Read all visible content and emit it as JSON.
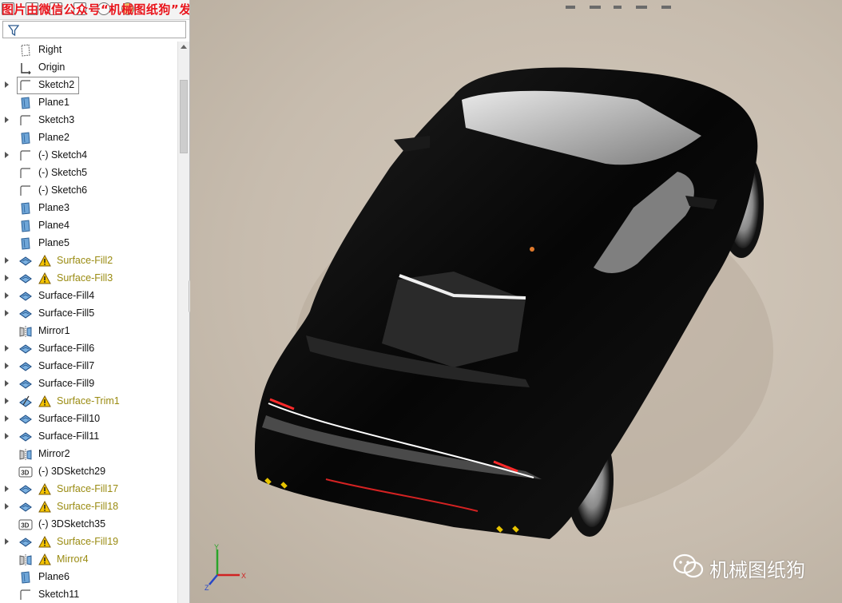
{
  "watermark_top": "图片由微信公众号“机械图纸狗”发布",
  "watermark_brand": "机械图纸狗",
  "colors": {
    "warning_text": "#9a8b12",
    "watermark_red": "#e8141b",
    "viewport_bg": "#c9bfb2",
    "car_body": "#0b0b0b"
  },
  "tree": {
    "items": [
      {
        "label": "Right",
        "icon": "plane-icon-outline",
        "expand": false,
        "warn": false
      },
      {
        "label": "Origin",
        "icon": "origin-icon",
        "expand": false,
        "warn": false
      },
      {
        "label": "Sketch2",
        "icon": "sketch-icon",
        "expand": true,
        "warn": false,
        "selected": true
      },
      {
        "label": "Plane1",
        "icon": "plane-icon",
        "expand": false,
        "warn": false
      },
      {
        "label": "Sketch3",
        "icon": "sketch-icon",
        "expand": true,
        "warn": false
      },
      {
        "label": "Plane2",
        "icon": "plane-icon",
        "expand": false,
        "warn": false
      },
      {
        "label": "(-) Sketch4",
        "icon": "sketch-icon",
        "expand": true,
        "warn": false
      },
      {
        "label": "(-) Sketch5",
        "icon": "sketch-icon",
        "expand": false,
        "warn": false
      },
      {
        "label": "(-) Sketch6",
        "icon": "sketch-icon",
        "expand": false,
        "warn": false
      },
      {
        "label": "Plane3",
        "icon": "plane-icon",
        "expand": false,
        "warn": false
      },
      {
        "label": "Plane4",
        "icon": "plane-icon",
        "expand": false,
        "warn": false
      },
      {
        "label": "Plane5",
        "icon": "plane-icon",
        "expand": false,
        "warn": false
      },
      {
        "label": "Surface-Fill2",
        "icon": "surface-fill-icon",
        "expand": true,
        "warn": true
      },
      {
        "label": "Surface-Fill3",
        "icon": "surface-fill-icon",
        "expand": true,
        "warn": true
      },
      {
        "label": "Surface-Fill4",
        "icon": "surface-fill-icon",
        "expand": true,
        "warn": false
      },
      {
        "label": "Surface-Fill5",
        "icon": "surface-fill-icon",
        "expand": true,
        "warn": false
      },
      {
        "label": "Mirror1",
        "icon": "mirror-icon",
        "expand": false,
        "warn": false
      },
      {
        "label": "Surface-Fill6",
        "icon": "surface-fill-icon",
        "expand": true,
        "warn": false
      },
      {
        "label": "Surface-Fill7",
        "icon": "surface-fill-icon",
        "expand": true,
        "warn": false
      },
      {
        "label": "Surface-Fill9",
        "icon": "surface-fill-icon",
        "expand": true,
        "warn": false
      },
      {
        "label": "Surface-Trim1",
        "icon": "surface-trim-icon",
        "expand": true,
        "warn": true
      },
      {
        "label": "Surface-Fill10",
        "icon": "surface-fill-icon",
        "expand": true,
        "warn": false
      },
      {
        "label": "Surface-Fill11",
        "icon": "surface-fill-icon",
        "expand": true,
        "warn": false
      },
      {
        "label": "Mirror2",
        "icon": "mirror-icon",
        "expand": false,
        "warn": false
      },
      {
        "label": "(-) 3DSketch29",
        "icon": "3dsketch-icon",
        "expand": false,
        "warn": false
      },
      {
        "label": "Surface-Fill17",
        "icon": "surface-fill-icon",
        "expand": true,
        "warn": true
      },
      {
        "label": "Surface-Fill18",
        "icon": "surface-fill-icon",
        "expand": true,
        "warn": true
      },
      {
        "label": "(-) 3DSketch35",
        "icon": "3dsketch-icon",
        "expand": false,
        "warn": false
      },
      {
        "label": "Surface-Fill19",
        "icon": "surface-fill-icon",
        "expand": true,
        "warn": true
      },
      {
        "label": "Mirror4",
        "icon": "mirror-icon",
        "expand": false,
        "warn": true
      },
      {
        "label": "Plane6",
        "icon": "plane-icon",
        "expand": false,
        "warn": false
      },
      {
        "label": "Sketch11",
        "icon": "sketch-icon",
        "expand": false,
        "warn": false
      }
    ]
  },
  "triad_labels": {
    "x": "X",
    "y": "Y",
    "z": "Z"
  }
}
